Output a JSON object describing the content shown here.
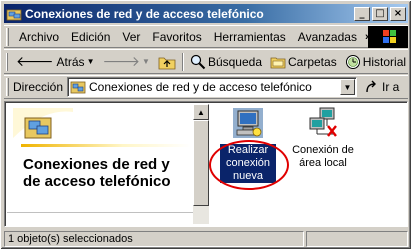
{
  "window": {
    "title": "Conexiones de red y de acceso telefónico",
    "minimize": "_",
    "maximize": "□",
    "close": "×"
  },
  "menubar": {
    "items": [
      {
        "label": "Archivo"
      },
      {
        "label": "Edición"
      },
      {
        "label": "Ver"
      },
      {
        "label": "Favoritos"
      },
      {
        "label": "Herramientas"
      },
      {
        "label": "Avanzadas"
      }
    ],
    "more": "»"
  },
  "toolbar": {
    "back": "Atrás",
    "search": "Búsqueda",
    "folders": "Carpetas",
    "history": "Historial",
    "more": "»"
  },
  "address": {
    "label": "Dirección",
    "value": "Conexiones de red y de acceso telefónico",
    "go": "Ir a"
  },
  "left_pane": {
    "title": "Conexiones de red y de acceso telefónico"
  },
  "items": [
    {
      "name": "make-new-connection",
      "label": "Realizar conexión nueva",
      "selected": true
    },
    {
      "name": "local-area-connection",
      "label": "Conexión de área local",
      "selected": false
    }
  ],
  "status": {
    "text": "1 objeto(s) seleccionados"
  },
  "colors": {
    "titlebar": "#0a246a",
    "selection": "#0a246a",
    "highlight_circle": "#e00000",
    "face": "#d4d0c8"
  }
}
